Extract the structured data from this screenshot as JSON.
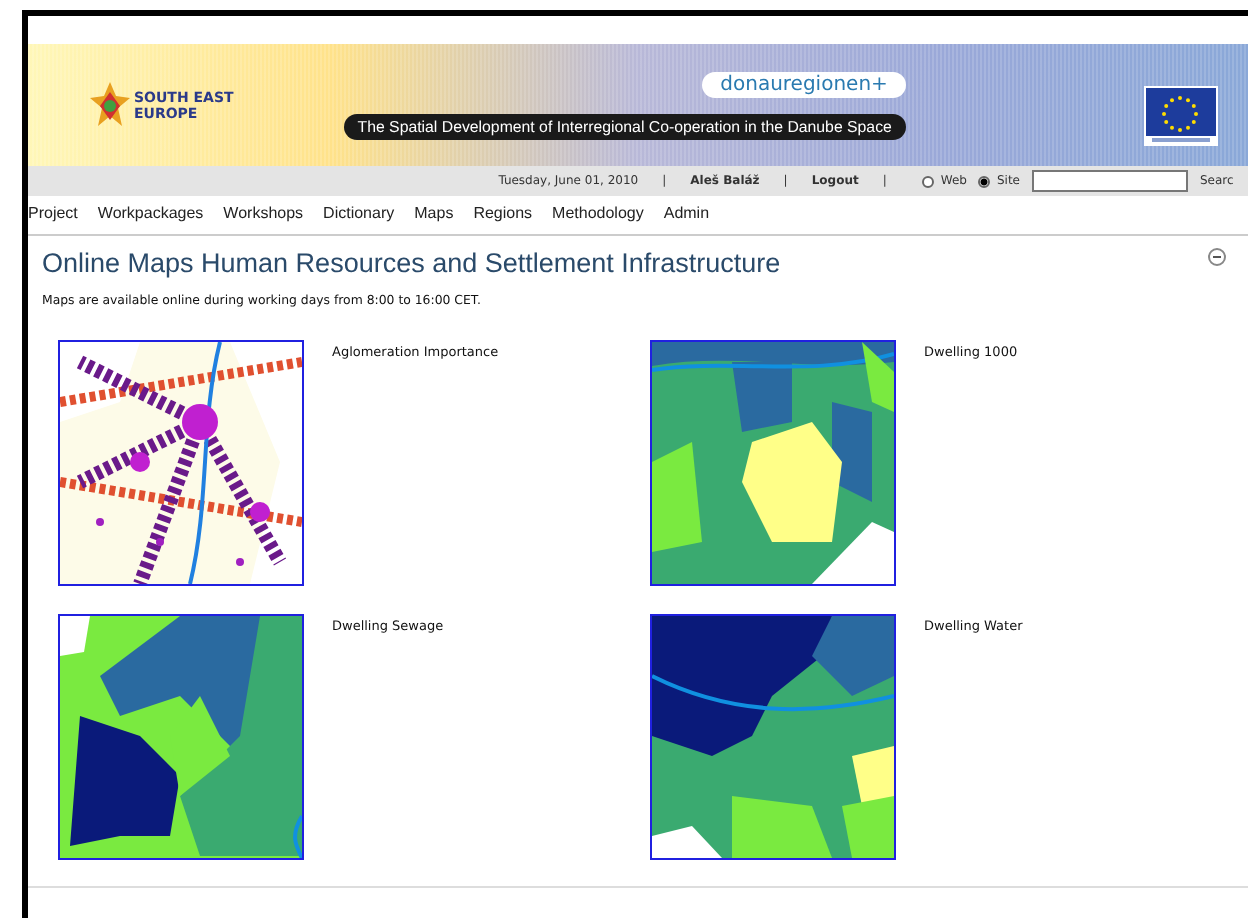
{
  "banner": {
    "program_logo": [
      "SOUTH EAST",
      "EUROPE"
    ],
    "brand": "donauregionen+",
    "slogan": "The Spatial Development of Interregional Co-operation in the Danube Space"
  },
  "user_bar": {
    "date": "Tuesday, June 01, 2010",
    "separators": [
      "|",
      "|",
      "|"
    ],
    "user": "Aleš Baláž",
    "logout": "Logout",
    "scopes": [
      {
        "label": "Web",
        "selected": false
      },
      {
        "label": "Site",
        "selected": true
      }
    ],
    "search_button": "Searc"
  },
  "nav": [
    {
      "label": "Project"
    },
    {
      "label": "Workpackages"
    },
    {
      "label": "Workshops"
    },
    {
      "label": "Dictionary"
    },
    {
      "label": "Maps"
    },
    {
      "label": "Regions"
    },
    {
      "label": "Methodology"
    },
    {
      "label": "Admin"
    }
  ],
  "page": {
    "title": "Online Maps Human Resources and Settlement Infrastructure",
    "note": "Maps are available online during working days from 8:00 to 16:00 CET."
  },
  "maps": [
    {
      "label": "Aglomeration Importance"
    },
    {
      "label": "Dwelling 1000"
    },
    {
      "label": "Dwelling Sewage"
    },
    {
      "label": "Dwelling Water"
    }
  ]
}
